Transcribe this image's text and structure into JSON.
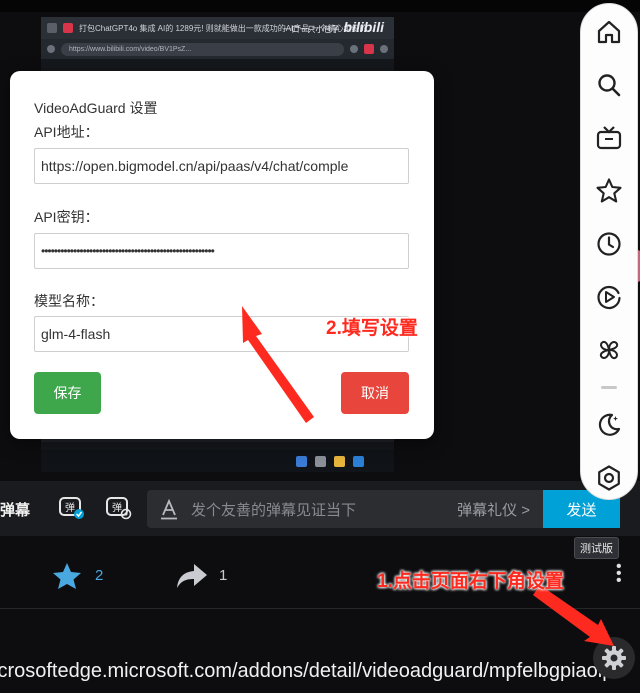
{
  "background": {
    "browser_tab_title": "打包ChatGPT4o 集成 AI的 1289元! 则就能做出一款成功的AI产品 一个精心组织的... ",
    "browser_url": "https://www.bilibili.com/video/BV1PsZ...",
    "bili_user": "一口一只小包子",
    "bili_logo": "bilibili"
  },
  "dialog": {
    "title": "VideoAdGuard 设置",
    "api_url_label": "API地址：",
    "api_url_value": "https://open.bigmodel.cn/api/paas/v4/chat/comple",
    "api_key_label": "API密钥：",
    "api_key_value": "••••••••••••••••••••••••••••••••••••••••••••••••••••••",
    "model_label": "模型名称：",
    "model_value": "glm-4-flash",
    "save_label": "保存",
    "cancel_label": "取消"
  },
  "annotations": {
    "step1": "1.点击页面右下角设置",
    "step2": "2.填写设置"
  },
  "danmaku": {
    "label": "弹幕",
    "placeholder": "发个友善的弹幕见证当下",
    "etiquette": "弹幕礼仪 >",
    "send_label": "发送"
  },
  "stats": {
    "favorites": "2",
    "shares": "1"
  },
  "footer_url": "icrosoftedge.microsoft.com/addons/detail/videoadguard/mpfelbgpiaolp",
  "sidebar": {
    "test_badge": "测试版",
    "icons": [
      "home-icon",
      "search-icon",
      "tv-icon",
      "star-icon",
      "clock-icon",
      "play-circle-icon",
      "pinwheel-icon",
      "moon-icon",
      "settings-icon"
    ]
  },
  "colors": {
    "save_button": "#3fa74b",
    "cancel_button": "#e8463c",
    "send_button": "#00a1d6",
    "annotation": "#ff2a1f",
    "fav_blue": "#4aa8e0"
  }
}
